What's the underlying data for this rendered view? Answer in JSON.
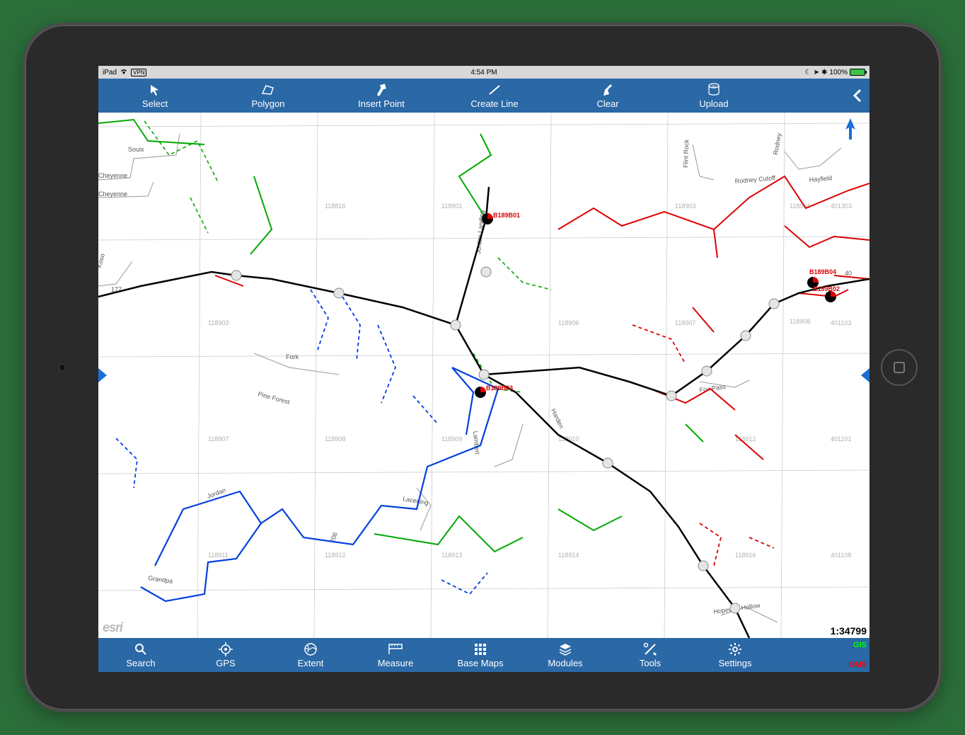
{
  "status_bar": {
    "device": "iPad",
    "vpn": "VPN",
    "time": "4:54 PM",
    "battery_pct": "100%"
  },
  "top_tools": {
    "select": "Select",
    "polygon": "Polygon",
    "insert_point": "Insert Point",
    "create_line": "Create Line",
    "clear": "Clear",
    "upload": "Upload"
  },
  "bottom_tools": {
    "search": "Search",
    "gps": "GPS",
    "extent": "Extent",
    "measure": "Measure",
    "basemaps": "Base Maps",
    "modules": "Modules",
    "tools": "Tools",
    "settings": "Settings"
  },
  "status_indicators": {
    "gis": "GIS",
    "oms": "OMS"
  },
  "map": {
    "scale": "1:34799",
    "attribution": "esri",
    "grid_cells": [
      "118816",
      "118901",
      "118903",
      "118904",
      "401303",
      "118903",
      "118906",
      "118907",
      "118908",
      "401103",
      "118907",
      "118908",
      "118909",
      "118910",
      "118912",
      "401101",
      "118911",
      "118912",
      "118913",
      "118914",
      "118916",
      "401108",
      "118903",
      "118907"
    ],
    "roads": [
      "Souix",
      "Cheyenne",
      "Cheyenne",
      "Koso",
      "177",
      "Fork",
      "Pine Forest",
      "Jordan",
      "Grandpa",
      "206",
      "Lambert",
      "Lacening",
      "Jordan Landing",
      "Harden",
      "Fox Pass",
      "Hopewell Hollow",
      "Flint Rock",
      "Rodney",
      "Rodney Cutoff",
      "Hayfield",
      "40"
    ],
    "nodes": [
      "B189B01",
      "B189B02",
      "B189B03",
      "B189B04"
    ]
  }
}
